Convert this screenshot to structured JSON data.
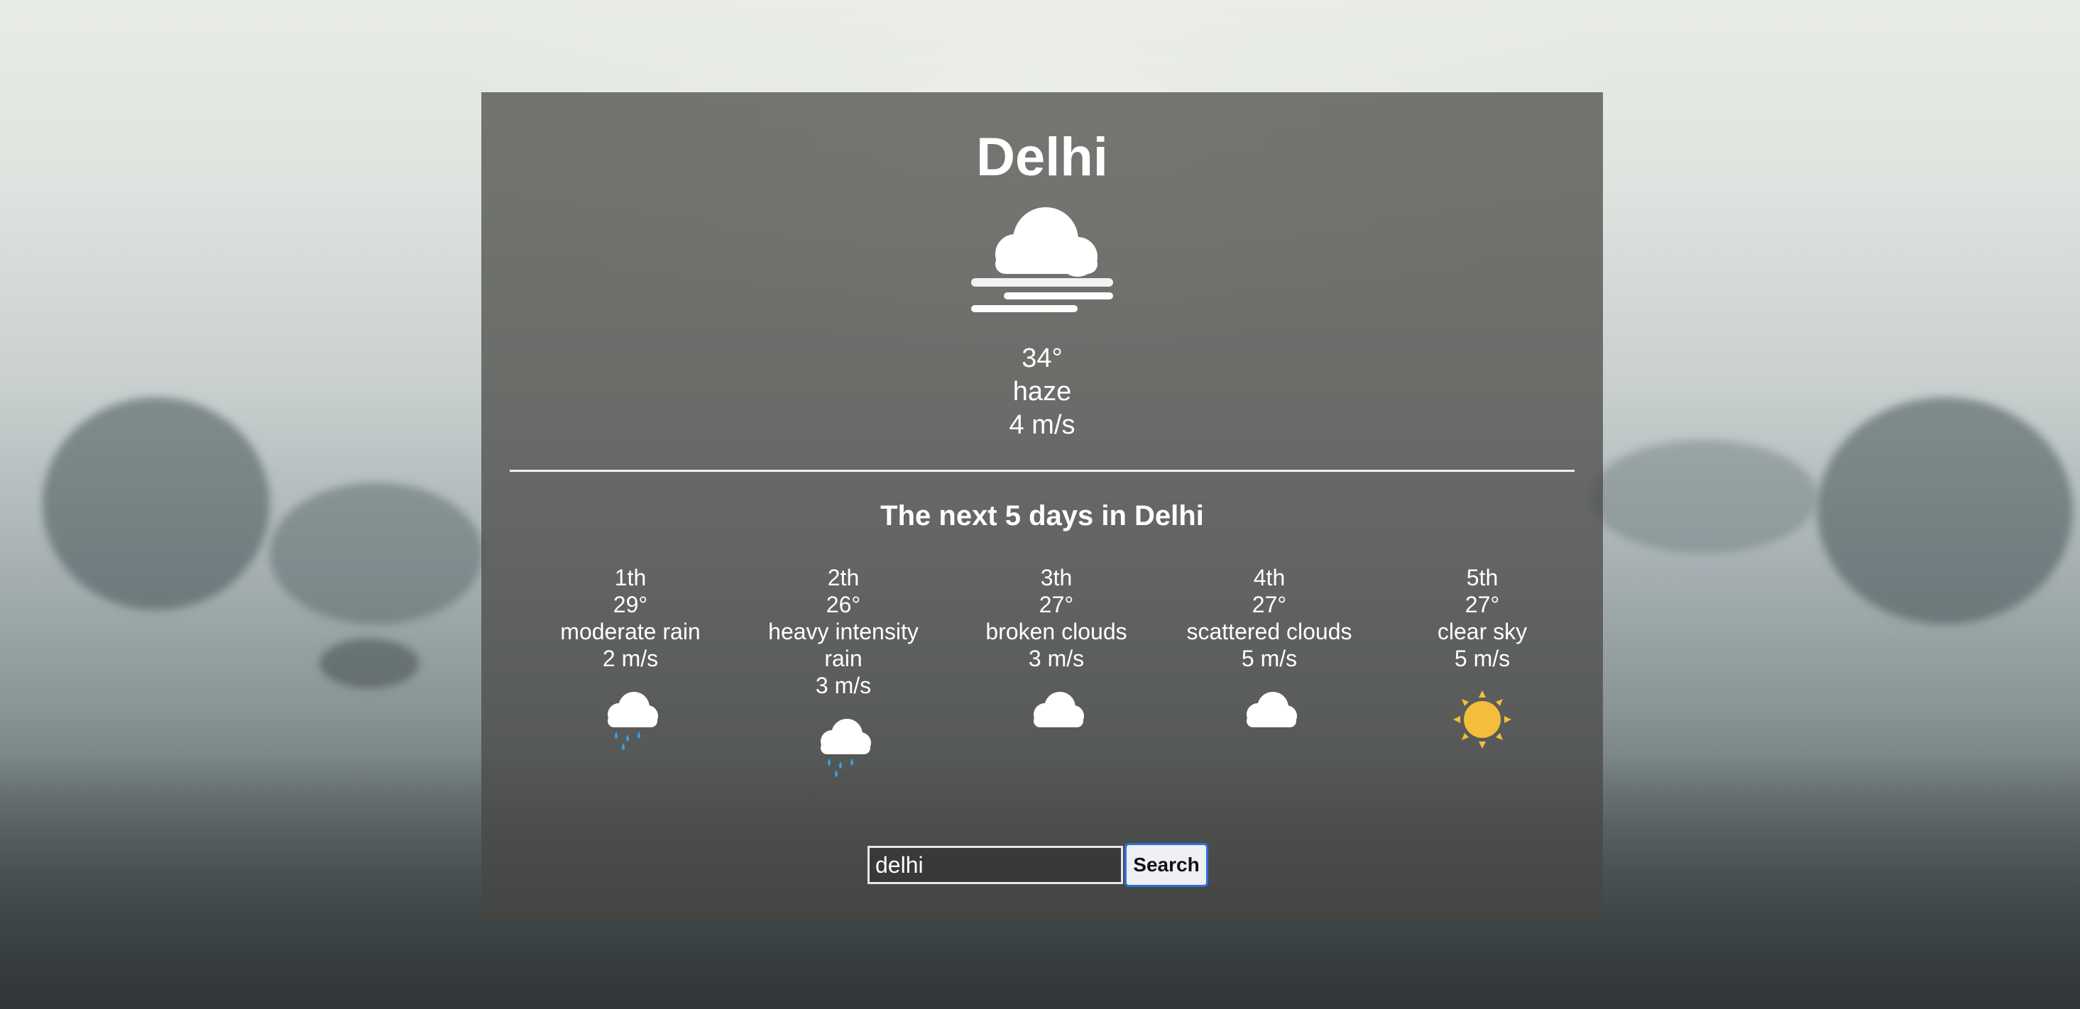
{
  "current": {
    "city": "Delhi",
    "icon": "haze-cloud-icon",
    "temp": "34°",
    "description": "haze",
    "wind": "4 m/s"
  },
  "forecast": {
    "title": "The next 5 days in Delhi",
    "days": [
      {
        "day": "1th",
        "temp": "29°",
        "description": "moderate rain",
        "wind": "2 m/s",
        "icon": "rain-cloud-icon"
      },
      {
        "day": "2th",
        "temp": "26°",
        "description": "heavy intensity rain",
        "wind": "3 m/s",
        "icon": "rain-cloud-icon"
      },
      {
        "day": "3th",
        "temp": "27°",
        "description": "broken clouds",
        "wind": "3 m/s",
        "icon": "cloud-icon"
      },
      {
        "day": "4th",
        "temp": "27°",
        "description": "scattered clouds",
        "wind": "5 m/s",
        "icon": "cloud-icon"
      },
      {
        "day": "5th",
        "temp": "27°",
        "description": "clear sky",
        "wind": "5 m/s",
        "icon": "sun-icon"
      }
    ]
  },
  "search": {
    "value": "delhi",
    "button_label": "Search"
  },
  "colors": {
    "sun": "#f5bd3c",
    "rain": "#3aa0e8",
    "button_border": "#2f6fdb"
  }
}
